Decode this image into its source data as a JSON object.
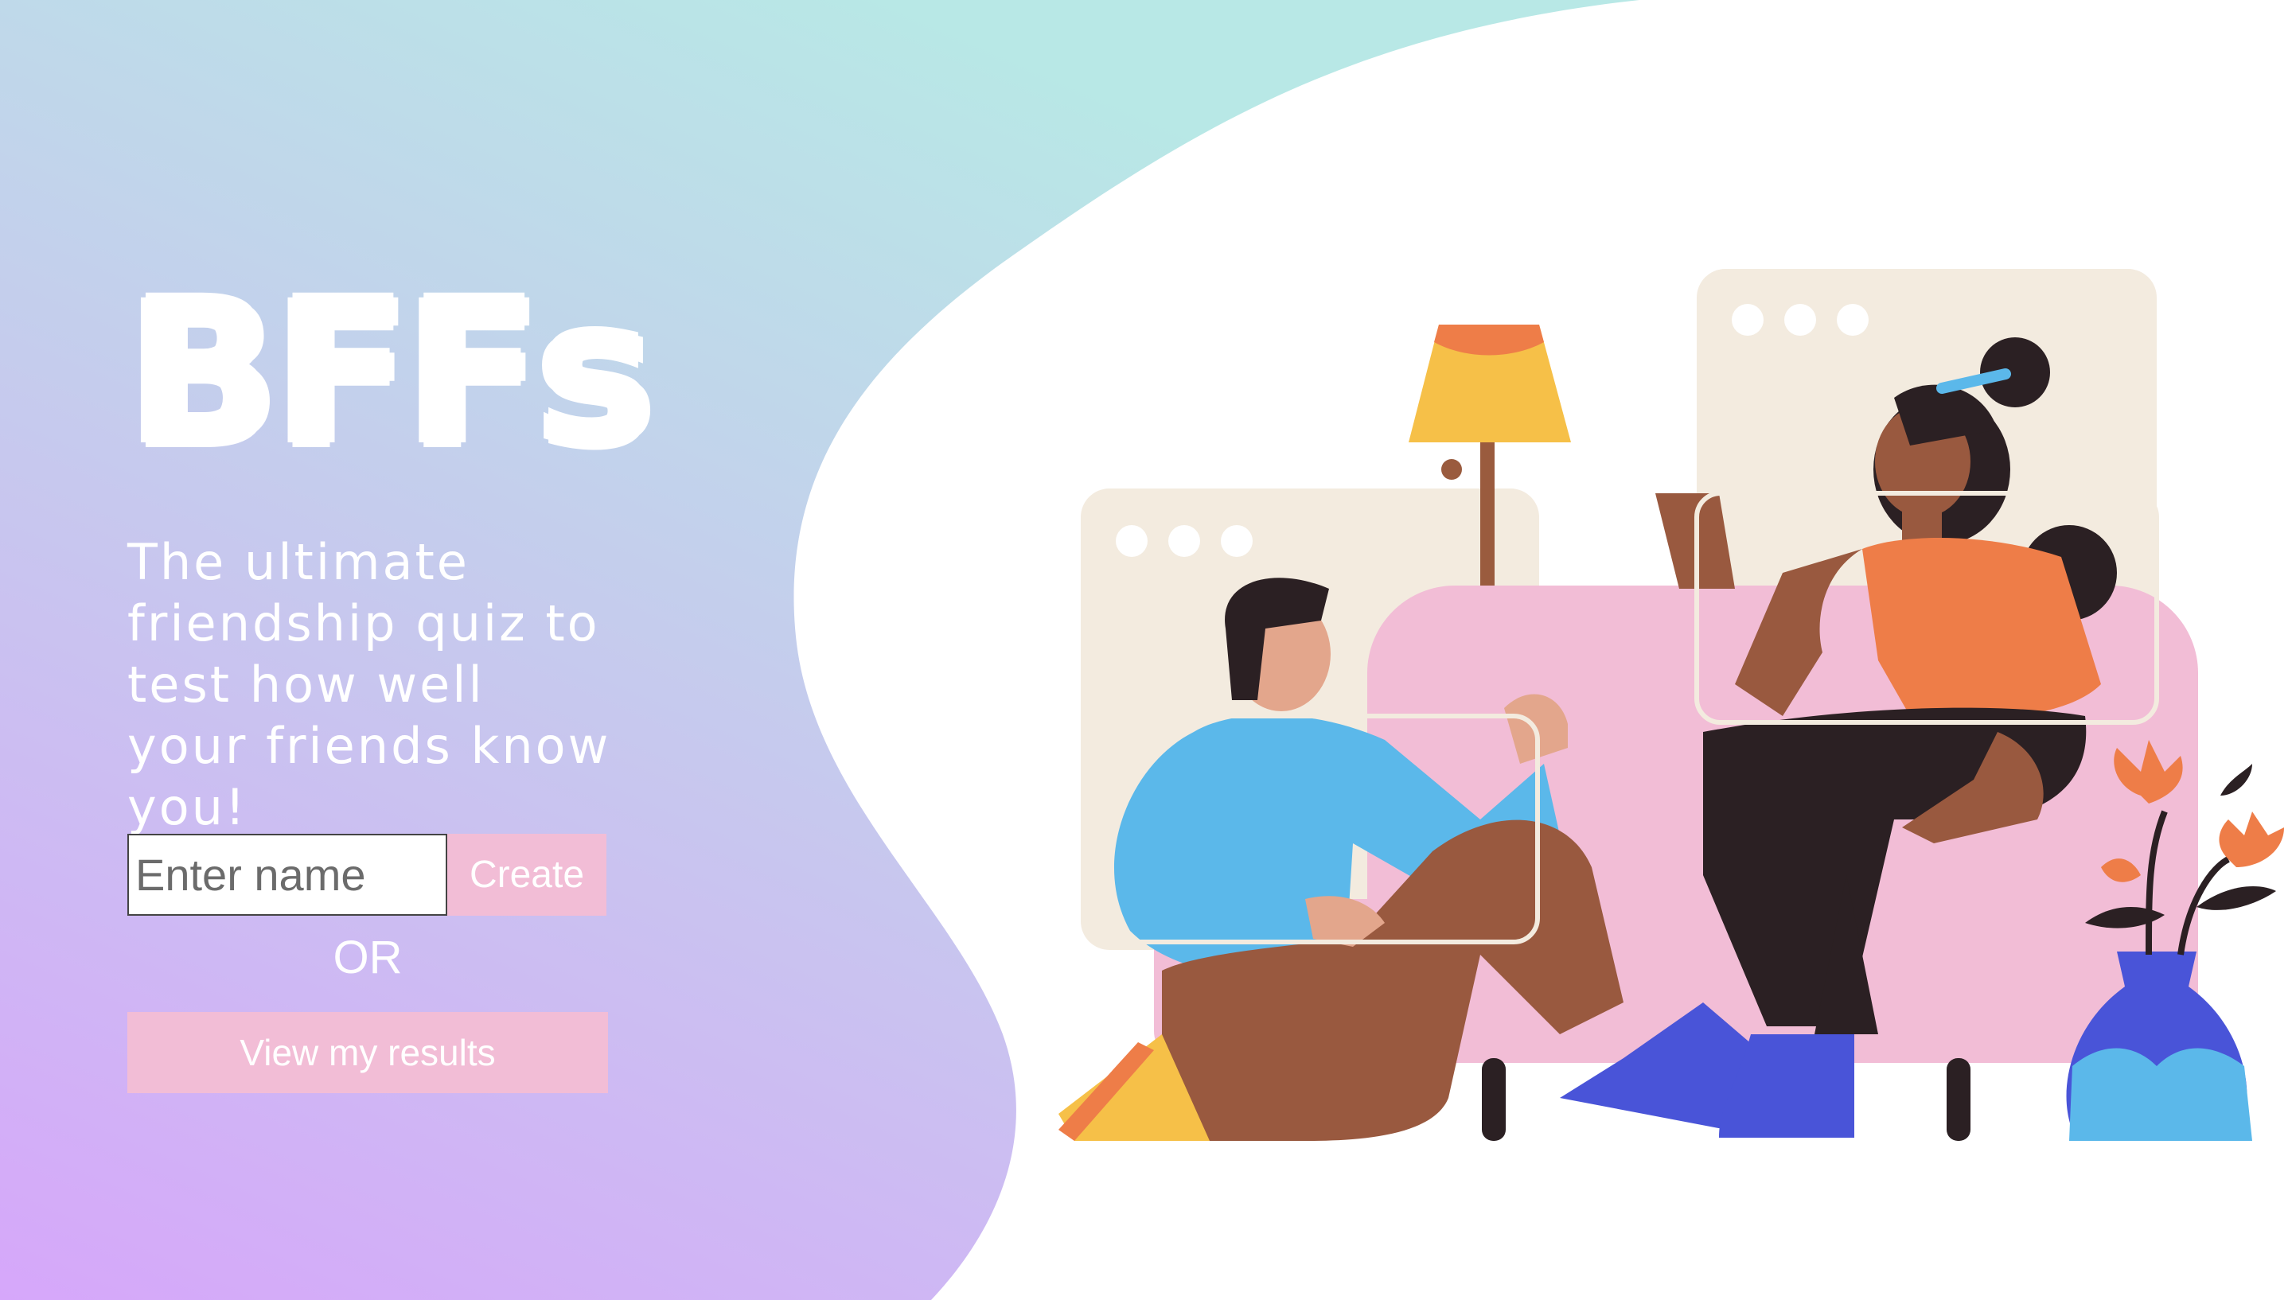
{
  "app": {
    "logo_text": "BFFs",
    "tagline": "The ultimate friendship quiz to test how well your friends know you!"
  },
  "form": {
    "name_placeholder": "Enter name",
    "create_label": "Create",
    "or_label": "OR",
    "results_label": "View my results"
  },
  "colors": {
    "button_bg": "#f2bdd6",
    "gradient_top": "#b8e8e8",
    "gradient_bottom": "#d6a8f8"
  }
}
